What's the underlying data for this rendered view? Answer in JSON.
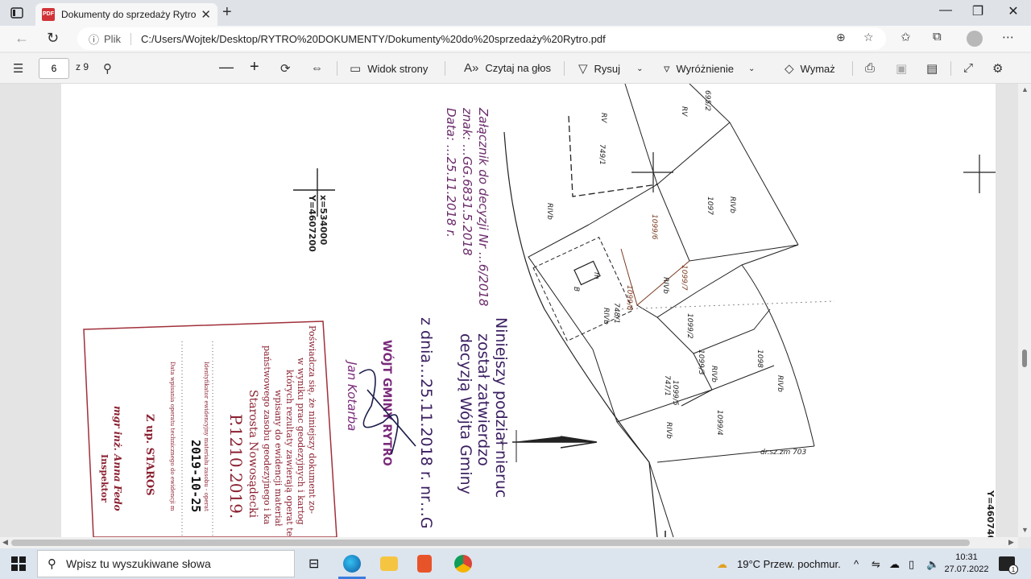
{
  "browser": {
    "tab_title": "Dokumenty do sprzedaży Rytro.pdf",
    "address": {
      "site_label": "Plik",
      "url": "C:/Users/Wojtek/Desktop/RYTRO%20DOKUMENTY/Dokumenty%20do%20sprzedaży%20Rytro.pdf"
    }
  },
  "pdf_toolbar": {
    "page_current": "6",
    "page_total": "z 9",
    "view_label": "Widok strony",
    "read_aloud_label": "Czytaj na głos",
    "draw_label": "Rysuj",
    "highlight_label": "Wyróżnienie",
    "erase_label": "Wymaż"
  },
  "document": {
    "coord_x": "x=534000",
    "coord_y": "Y=4607200",
    "coord_y_right": "Y=4607400",
    "attachment_line1": "Załącznik do decyzji Nr …6/2018",
    "attachment_line2": "znak: …GG.6831.5.2018",
    "attachment_line3": "Data: …25.11.2018 r.",
    "approval_line1": "Niniejszy podział nieruc",
    "approval_line2": "został zatwierdzo",
    "approval_line3": "decyzją Wójta Gminy",
    "approval_line4": "z dnia…25.11.2018 r. nr…G",
    "mayor_title": "WÓJT GMINY RYTRO",
    "mayor_name": "Jan Kotarba",
    "stamp_line1": "Poświadcza się, że niniejszy dokument zo-",
    "stamp_line2": "w wyniku prac geodezyjnych i kartog",
    "stamp_line3": "których rezultaty zawierają operat te",
    "stamp_line4": "wpisany do ewidencji materiał",
    "stamp_line5": "państwowego zasobu geodezyjnego i ka",
    "stamp_line6": "Starosta Nowosądecki",
    "stamp_id": "P.1210.2019.",
    "stamp_sub1": "Identyfikator ewidencyjny materiału zasobu - operat",
    "stamp_date": "2019-10-25",
    "stamp_sub2": "Data wpisania operatu technicznego do ewidencji m",
    "stamp_zup": "Z up. STAROS",
    "stamp_sign": "mgr inż. Anna Fedo",
    "stamp_role": "Inspektor",
    "parcels": [
      "695/2",
      "RV",
      "749/1",
      "RIVb",
      "1097",
      "1099/6",
      "1099/7",
      "1099/8",
      "1099/2",
      "1099/3",
      "1099/4",
      "1099/5",
      "1098",
      "747/1",
      "748/1",
      "B",
      "m"
    ],
    "road_label": "dr.sz.zm 703"
  },
  "taskbar": {
    "search_placeholder": "Wpisz tu wyszukiwane słowa",
    "weather": "19°C  Przew. pochmur.",
    "time": "10:31",
    "date": "27.07.2022",
    "notif_count": "1"
  }
}
